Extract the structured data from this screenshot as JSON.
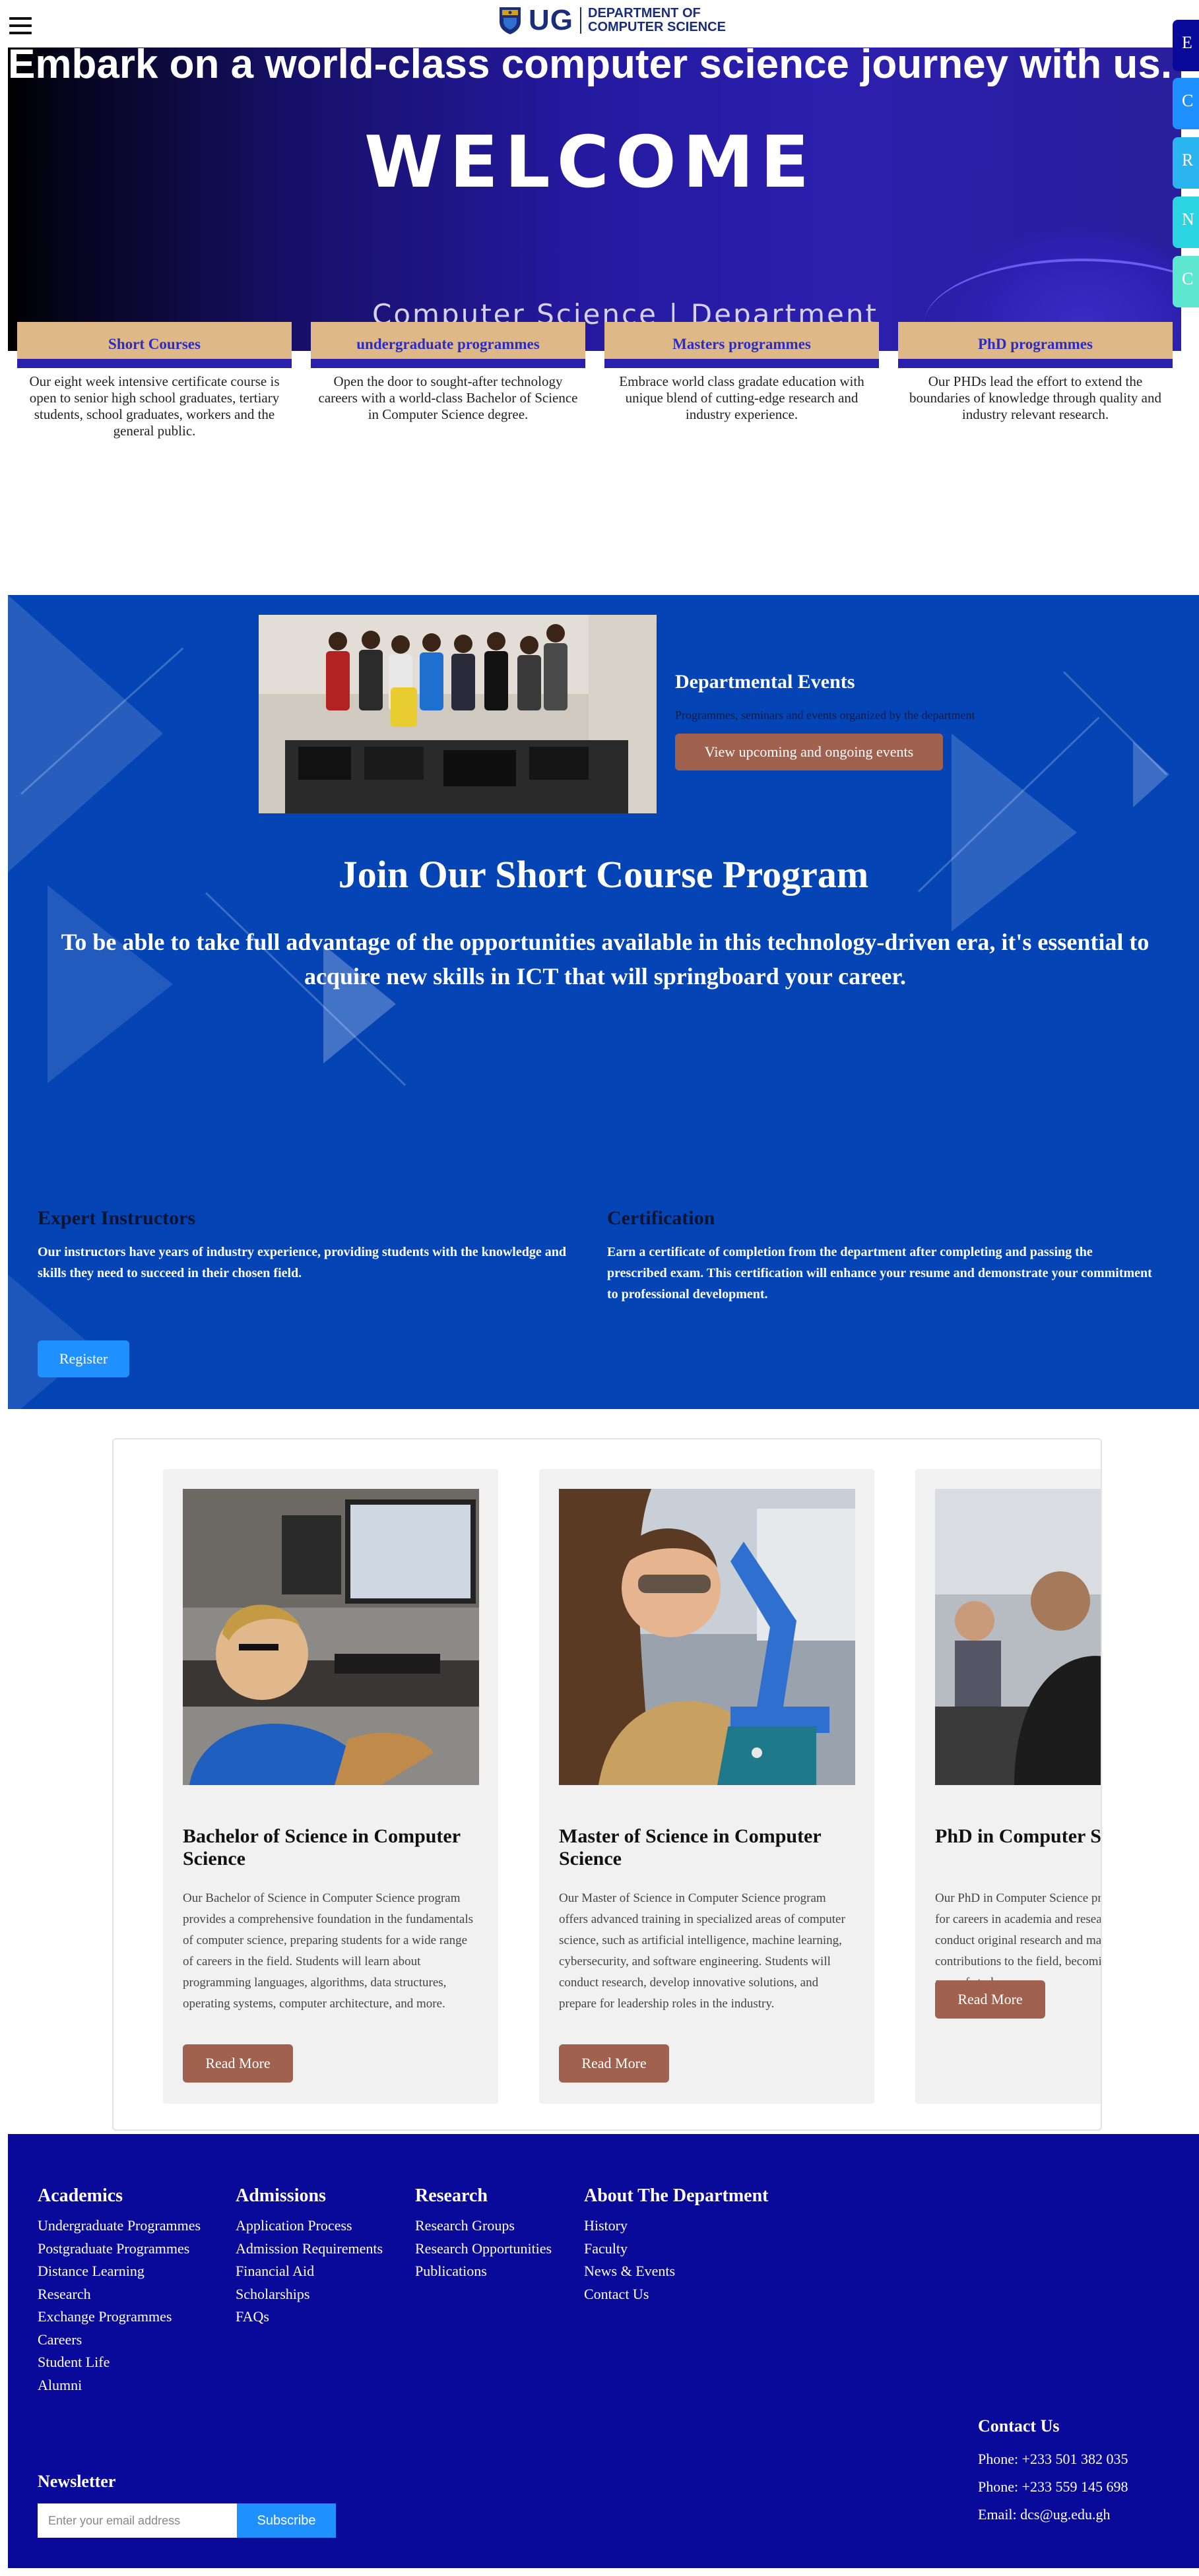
{
  "header": {
    "logo_text": "UG",
    "dept_line1": "DEPARTMENT OF",
    "dept_line2": "COMPUTER SCIENCE"
  },
  "hero": {
    "headline": "Embark on a world-class computer science journey with us.",
    "welcome": "WELCOME",
    "dept_text": "Computer  Science | Department"
  },
  "side_buttons": [
    {
      "label": "E",
      "color": "#0a0a9a"
    },
    {
      "label": "C",
      "color": "#1e90ff"
    },
    {
      "label": "R",
      "color": "#2bb5f0"
    },
    {
      "label": "N",
      "color": "#2ad4e0"
    },
    {
      "label": "C",
      "color": "#5de6d0"
    }
  ],
  "programs": [
    {
      "title": "Short Courses",
      "desc": "Our eight week intensive certificate course is open to senior high school graduates, tertiary students, school graduates, workers and the general public."
    },
    {
      "title": "undergraduate programmes",
      "desc": "Open the door to sought-after technology careers with a world-class Bachelor of Science in Computer Science degree."
    },
    {
      "title": "Masters programmes",
      "desc": "Embrace world class gradate education with unique blend of cutting-edge research and industry experience."
    },
    {
      "title": "PhD programmes",
      "desc": "Our PHDs lead the effort to extend the boundaries of knowledge through quality and industry relevant research."
    }
  ],
  "events": {
    "title": "Departmental Events",
    "subtitle": "Programmes, seminars and events organized by the department",
    "button": "View upcoming and ongoing events"
  },
  "short_course": {
    "title": "Join Our Short Course Program",
    "text": "To be able to take full advantage of the opportunities available in this technology-driven era, it's essential to acquire new skills in ICT that will springboard your career.",
    "features": [
      {
        "title": "Expert Instructors",
        "text": "Our instructors have years of industry experience, providing students with the knowledge and skills they need to succeed in their chosen field."
      },
      {
        "title": "Certification",
        "text": "Earn a certificate of completion from the department after completing and passing the prescribed exam. This certification will enhance your resume and demonstrate your commitment to professional development."
      }
    ],
    "register": "Register"
  },
  "degrees": [
    {
      "title": "Bachelor of Science in Computer Science",
      "text": "Our Bachelor of Science in Computer Science program provides a comprehensive foundation in the fundamentals of computer science, preparing students for a wide range of careers in the field. Students will learn about programming languages, algorithms, data structures, operating systems, computer architecture, and more.",
      "button": "Read More"
    },
    {
      "title": "Master of Science in Computer Science",
      "text": "Our Master of Science in Computer Science program offers advanced training in specialized areas of computer science, such as artificial intelligence, machine learning, cybersecurity, and software engineering. Students will conduct research, develop innovative solutions, and prepare for leadership roles in the industry.",
      "button": "Read More"
    },
    {
      "title": "PhD in Computer Science",
      "text": "Our PhD in Computer Science program prepares students for careers in academia and research. Students will conduct original research and make significant contributions to the field, becoming experts in their chosen area of study.",
      "button": "Read More"
    }
  ],
  "footer": {
    "columns": [
      {
        "title": "Academics",
        "links": [
          "Undergraduate Programmes",
          "Postgraduate Programmes",
          "Distance Learning",
          "Research",
          "Exchange Programmes",
          "Careers",
          "Student Life",
          "Alumni"
        ]
      },
      {
        "title": "Admissions",
        "links": [
          "Application Process",
          "Admission Requirements",
          "Financial Aid",
          "Scholarships",
          "FAQs"
        ]
      },
      {
        "title": "Research",
        "links": [
          "Research Groups",
          "Research Opportunities",
          "Publications"
        ]
      },
      {
        "title": "About The Department",
        "links": [
          "History",
          "Faculty",
          "News & Events",
          "Contact Us"
        ]
      }
    ],
    "newsletter": {
      "title": "Newsletter",
      "placeholder": "Enter your email address",
      "button": "Subscribe"
    },
    "contact": {
      "title": "Contact Us",
      "phone1": "Phone: +233 501 382 035",
      "phone2": "Phone: +233 559 145 698",
      "email": "Email: dcs@ug.edu.gh"
    }
  }
}
